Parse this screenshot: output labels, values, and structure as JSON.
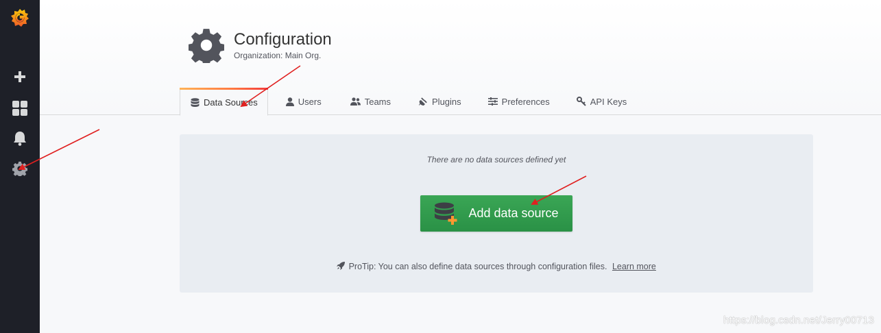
{
  "sidebar": {
    "items": [
      {
        "icon": "grafana-logo-icon"
      },
      {
        "icon": "plus-icon"
      },
      {
        "icon": "dashboards-icon"
      },
      {
        "icon": "bell-icon"
      },
      {
        "icon": "gear-icon"
      }
    ]
  },
  "header": {
    "title": "Configuration",
    "subtitle": "Organization: Main Org."
  },
  "tabs": [
    {
      "label": "Data Sources",
      "icon": "database-icon",
      "active": true
    },
    {
      "label": "Users",
      "icon": "user-icon"
    },
    {
      "label": "Teams",
      "icon": "team-icon"
    },
    {
      "label": "Plugins",
      "icon": "plug-icon"
    },
    {
      "label": "Preferences",
      "icon": "sliders-icon"
    },
    {
      "label": "API Keys",
      "icon": "key-icon"
    }
  ],
  "empty_state": {
    "message": "There are no data sources defined yet",
    "button_label": "Add data source",
    "protip": "ProTip: You can also define data sources through configuration files.",
    "learn_more": "Learn more"
  },
  "watermark": "https://blog.csdn.net/Jerry00713",
  "colors": {
    "sidebar": "#1e2028",
    "button_green": "#2f9a4c",
    "tab_accent": "#ff7941",
    "annotation_arrow": "#e02020"
  }
}
